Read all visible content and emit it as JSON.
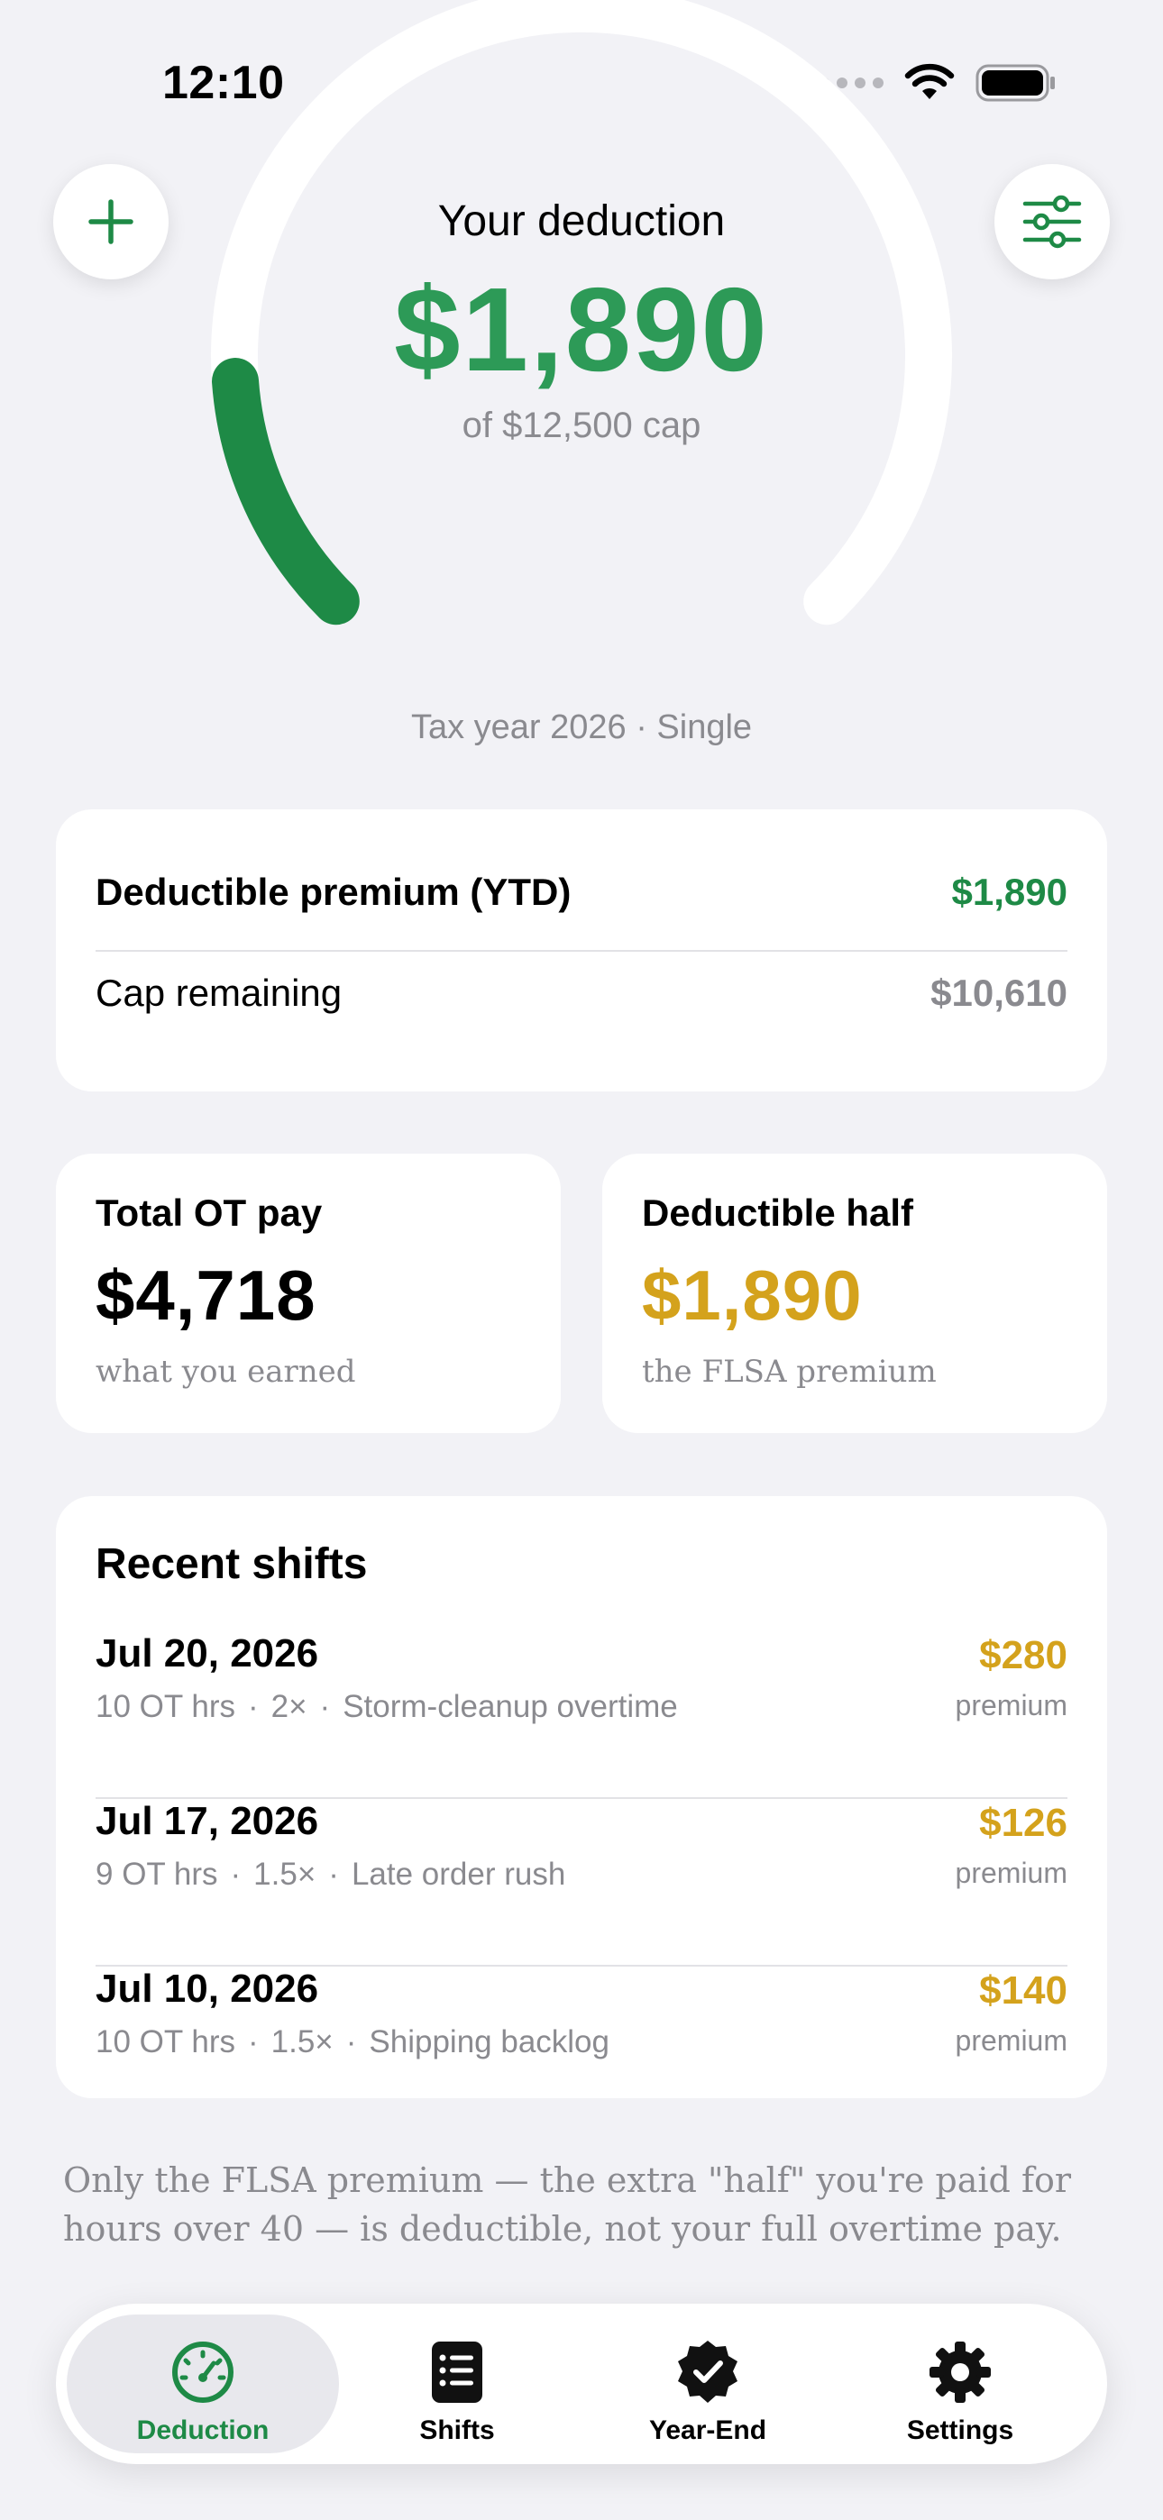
{
  "status_bar": {
    "time": "12:10"
  },
  "header": {
    "title": "Your deduction",
    "amount": "$1,890",
    "cap_text": "of $12,500 cap",
    "progress_fraction": 0.1512,
    "tax_year_text": "Tax year 2026 · Single"
  },
  "summary": {
    "deductible_label": "Deductible premium (YTD)",
    "deductible_value": "$1,890",
    "remaining_label": "Cap remaining",
    "remaining_value": "$10,610"
  },
  "stats": {
    "total_ot": {
      "title": "Total OT pay",
      "value": "$4,718",
      "sub": "what you earned"
    },
    "deductible_half": {
      "title": "Deductible half",
      "value": "$1,890",
      "sub": "the FLSA premium"
    }
  },
  "recent_shifts": {
    "title": "Recent shifts",
    "items": [
      {
        "date": "Jul 20, 2026",
        "hours": "10 OT hrs",
        "multiplier": "2×",
        "note": "Storm-cleanup overtime",
        "amount": "$280",
        "amount_label": "premium"
      },
      {
        "date": "Jul 17, 2026",
        "hours": "9 OT hrs",
        "multiplier": "1.5×",
        "note": "Late order rush",
        "amount": "$126",
        "amount_label": "premium"
      },
      {
        "date": "Jul 10, 2026",
        "hours": "10 OT hrs",
        "multiplier": "1.5×",
        "note": "Shipping backlog",
        "amount": "$140",
        "amount_label": "premium"
      }
    ]
  },
  "footnote": "Only the FLSA premium — the extra \"half\" you're paid for hours over 40 — is deductible, not your full overtime pay.",
  "tabs": [
    {
      "label": "Deduction",
      "icon": "gauge-icon",
      "active": true
    },
    {
      "label": "Shifts",
      "icon": "list-icon",
      "active": false
    },
    {
      "label": "Year-End",
      "icon": "checkmark-seal-icon",
      "active": false
    },
    {
      "label": "Settings",
      "icon": "gear-icon",
      "active": false
    }
  ],
  "colors": {
    "accent_green": "#1e8a46",
    "amount_green": "#2d9a57",
    "premium_gold": "#d4a21c",
    "muted_gray": "#8a8a8f",
    "background": "#f2f2f6"
  }
}
